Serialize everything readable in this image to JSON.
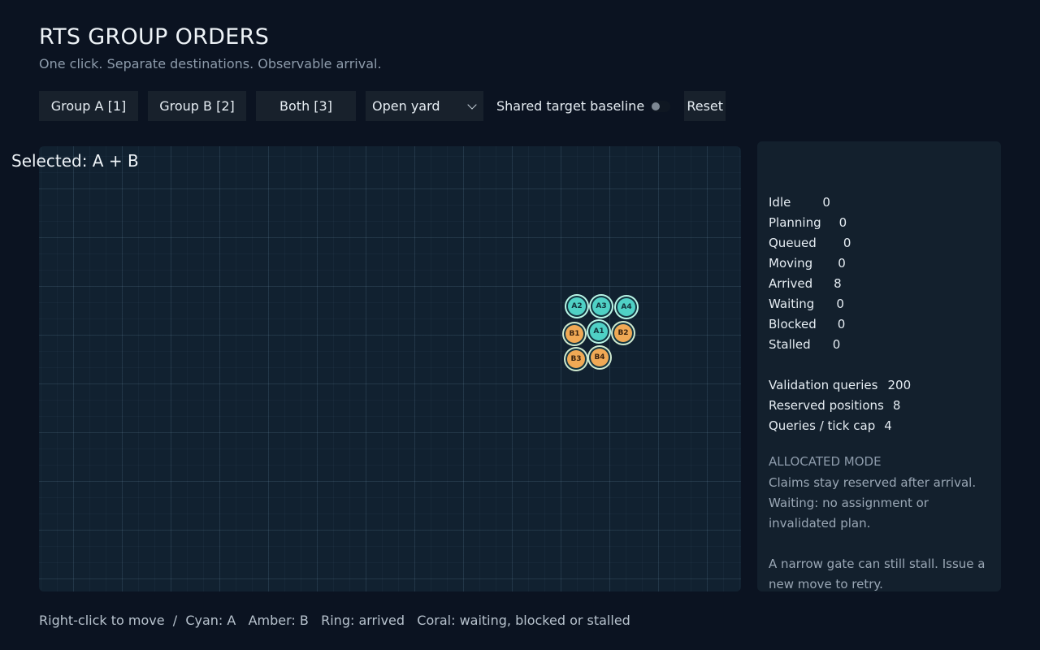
{
  "header": {
    "title": "RTS GROUP ORDERS",
    "subtitle": "One click. Separate destinations. Observable arrival."
  },
  "toolbar": {
    "group_a": "Group A [1]",
    "group_b": "Group B [2]",
    "both": "Both [3]",
    "map_select": {
      "value": "Open yard"
    },
    "toggle_label": "Shared target baseline",
    "toggle_on": false,
    "reset": "Reset"
  },
  "units": [
    {
      "id": "A2",
      "group": "A"
    },
    {
      "id": "A3",
      "group": "A"
    },
    {
      "id": "A4",
      "group": "A"
    },
    {
      "id": "B1",
      "group": "B"
    },
    {
      "id": "A1",
      "group": "A"
    },
    {
      "id": "B2",
      "group": "B"
    },
    {
      "id": "B3",
      "group": "B"
    },
    {
      "id": "B4",
      "group": "B"
    }
  ],
  "panel": {
    "title": "Selected: A + B",
    "states": [
      {
        "label": "Idle",
        "value": "0"
      },
      {
        "label": "Planning",
        "value": "0"
      },
      {
        "label": "Queued",
        "value": "0"
      },
      {
        "label": "Moving",
        "value": "0"
      },
      {
        "label": "Arrived",
        "value": "8"
      },
      {
        "label": "Waiting",
        "value": "0"
      },
      {
        "label": "Blocked",
        "value": "0"
      },
      {
        "label": "Stalled",
        "value": "0"
      }
    ],
    "metrics": [
      {
        "label": "Validation queries",
        "value": "200"
      },
      {
        "label": "Reserved positions",
        "value": "8"
      },
      {
        "label": "Queries / tick cap",
        "value": "4"
      }
    ],
    "mode_label": "ALLOCATED MODE",
    "mode_text_1": "Claims stay reserved after arrival.",
    "mode_text_2": "Waiting: no assignment or invalidated plan.",
    "mode_text_3": "A narrow gate can still stall. Issue a new move to retry."
  },
  "legend": {
    "text": "Right-click to move  /  Cyan: A   Amber: B   Ring: arrived   Coral: waiting, blocked or stalled"
  },
  "colors": {
    "group_a": "#4fd1c5",
    "group_b": "#f0a955",
    "arrived_ring": "#b9f5e6",
    "background": "#0b1321"
  }
}
